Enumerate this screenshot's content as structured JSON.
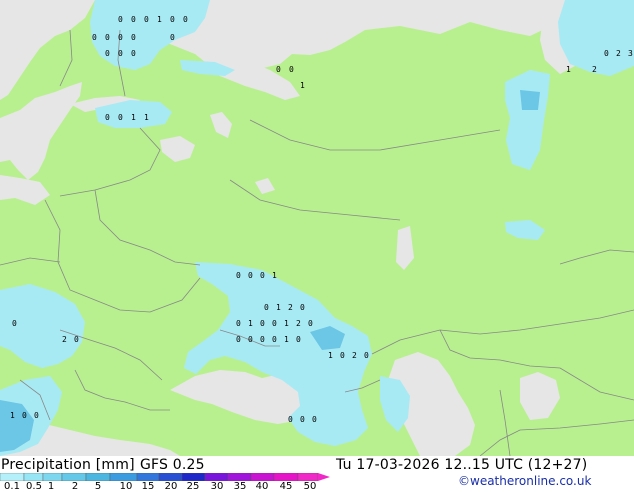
{
  "title": {
    "product": "Precipitation [mm]",
    "model": "GFS 0.25",
    "datetime": "Tu 17-03-2026 12..15 UTC (12+27)"
  },
  "legend": {
    "ticks": [
      "0.1",
      "0.5",
      "1",
      "2",
      "5",
      "10",
      "15",
      "20",
      "25",
      "30",
      "35",
      "40",
      "45",
      "50"
    ],
    "colors": [
      "#b4f0fa",
      "#96e6f5",
      "#7dd7ee",
      "#64c8e8",
      "#4bb6e0",
      "#3c9ce0",
      "#3278dc",
      "#2850d2",
      "#1e28c8",
      "#7814dc",
      "#a014dc",
      "#c814d2",
      "#e614c8",
      "#f028c8"
    ]
  },
  "credit": "©weatheronline.co.uk",
  "colors": {
    "land": "#b8f08f",
    "water": "#e6e6e6",
    "border": "#888888",
    "precip": "#a8eaf4",
    "precip_heavy": "#6cc6e6"
  },
  "map_values": {
    "row_1": [
      "0",
      "0",
      "0",
      "1",
      "0",
      "0"
    ],
    "row_2": [
      "0",
      "0",
      "0",
      "0",
      "0"
    ],
    "row_3": [
      "0",
      "0",
      "0"
    ],
    "row_4": [
      "0",
      "0",
      "1",
      "1"
    ],
    "row_5": [
      "0",
      "0",
      "1"
    ],
    "row_6": [
      "1",
      "2"
    ],
    "row_7": [
      "0",
      "2",
      "3"
    ],
    "row_8": [
      "0",
      "0",
      "0",
      "1"
    ],
    "row_9": [
      "0",
      "1",
      "2",
      "0"
    ],
    "row_10": [
      "0",
      "1",
      "0",
      "0",
      "1",
      "2",
      "0"
    ],
    "row_11": [
      "0",
      "0",
      "0",
      "0",
      "1",
      "0"
    ],
    "row_12": [
      "1",
      "0",
      "2",
      "0"
    ],
    "row_13": [
      "2",
      "0",
      "0"
    ],
    "row_14": [
      "1",
      "0",
      "0"
    ],
    "row_15": [
      "0",
      "0",
      "0"
    ]
  }
}
